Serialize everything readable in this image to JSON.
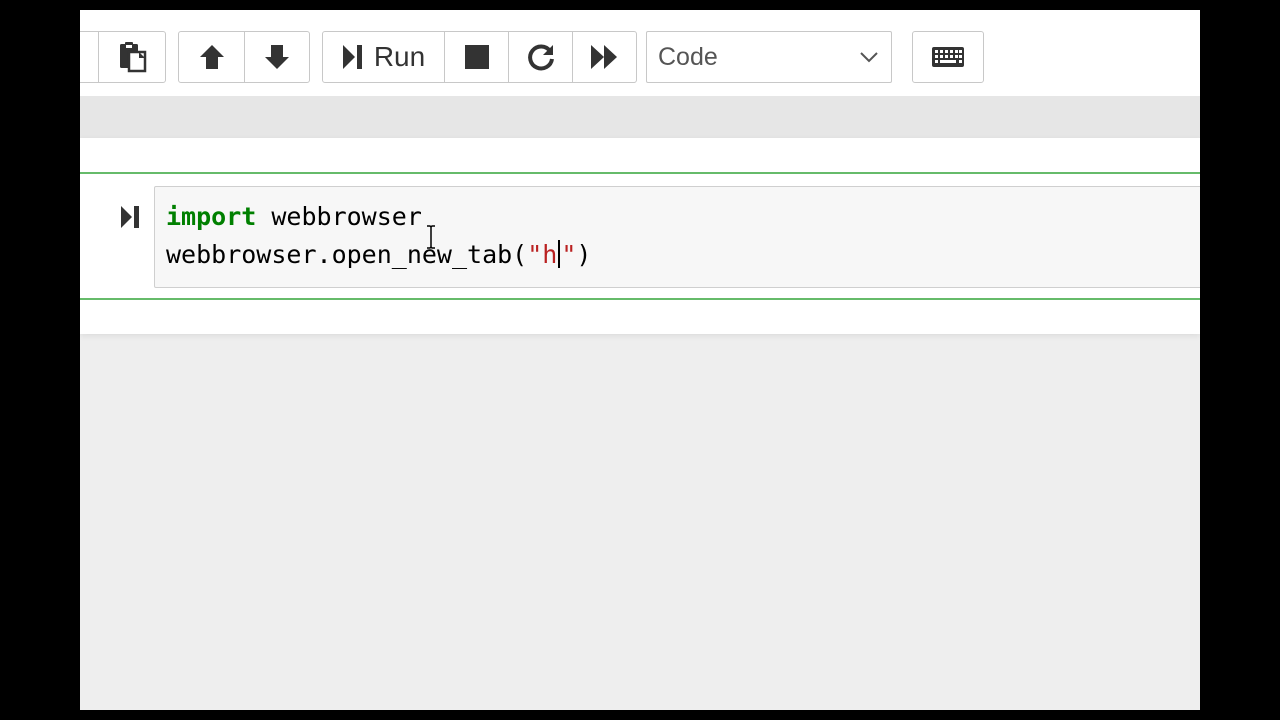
{
  "toolbar": {
    "run_label": "Run",
    "cell_type": "Code",
    "icons": [
      "paste-icon",
      "move-up-icon",
      "move-down-icon",
      "run-icon",
      "stop-icon",
      "restart-icon",
      "fast-forward-icon",
      "chevron-down-icon",
      "keyboard-icon"
    ]
  },
  "cell": {
    "prompt_icon": "run-cell-icon",
    "line1": {
      "keyword": "import",
      "rest": " webbrowser"
    },
    "line2": {
      "prefix": "webbrowser.open_new_tab(",
      "string_open": "\"h",
      "string_close": "\"",
      "suffix": ")"
    }
  },
  "colors": {
    "keyword": "#008000",
    "string": "#ba2121",
    "cell_border": "#66bb6a",
    "toolbar_bg": "#ffffff",
    "page_bg": "#eeeeee"
  }
}
